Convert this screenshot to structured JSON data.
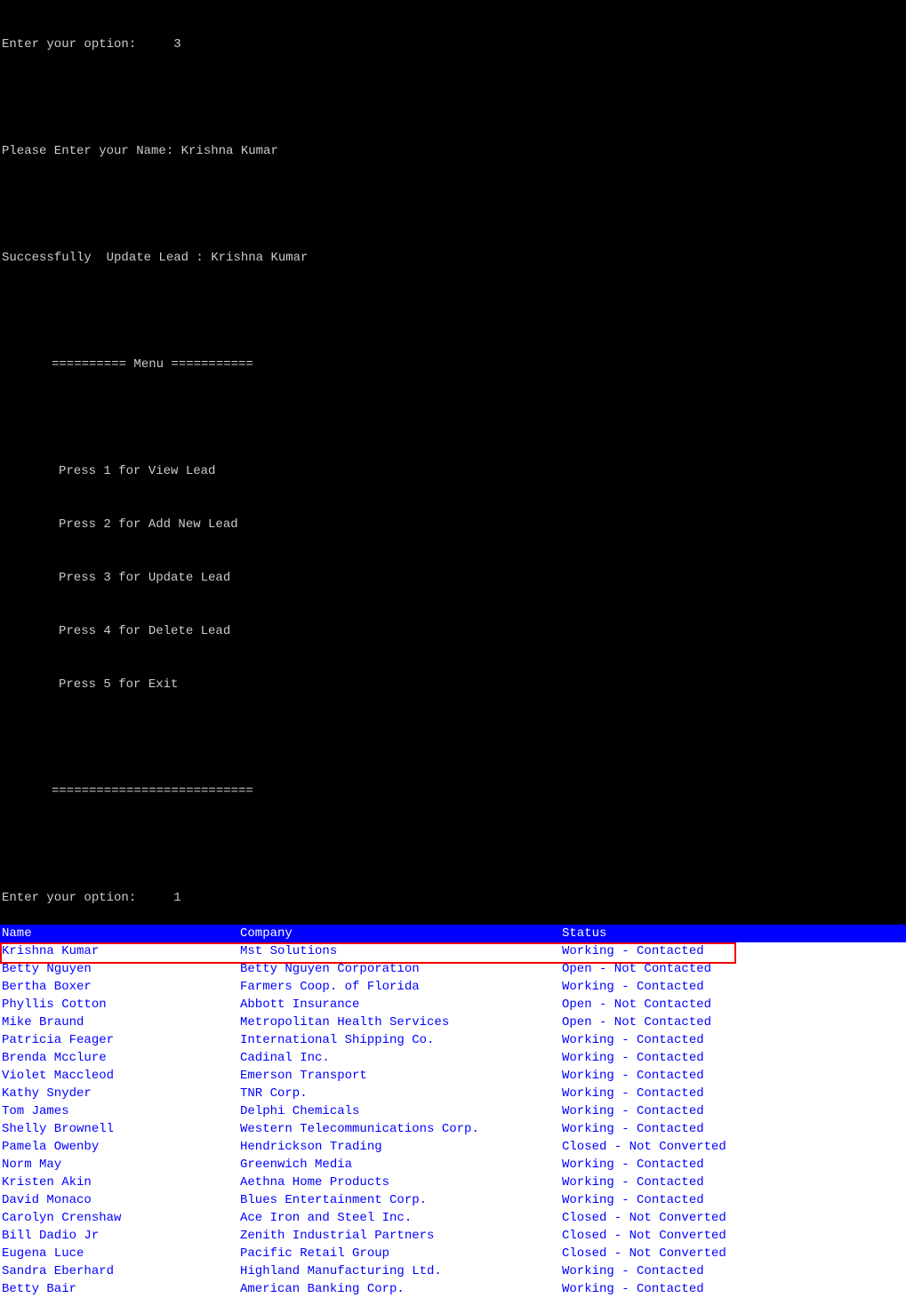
{
  "terminal": {
    "prompt1": "Enter your option:     3",
    "prompt2": "Please Enter your Name: Krishna Kumar",
    "success": "Successfully  Update Lead : Krishna Kumar",
    "menu_header": "========== Menu ===========",
    "menu_items": [
      "Press 1 for View Lead",
      "Press 2 for Add New Lead",
      "Press 3 for Update Lead",
      "Press 4 for Delete Lead",
      "Press 5 for Exit"
    ],
    "menu_footer": "===========================",
    "prompt3": "Enter your option:     1"
  },
  "table": {
    "headers": {
      "name": "Name",
      "company": "Company",
      "status": "Status"
    },
    "rows": [
      {
        "name": "Krishna Kumar",
        "company": "Mst Solutions",
        "status": "Working - Contacted",
        "highlighted": true
      },
      {
        "name": "Betty Nguyen",
        "company": "Betty Nguyen Corporation",
        "status": "Open - Not Contacted"
      },
      {
        "name": "Bertha Boxer",
        "company": "Farmers Coop. of Florida",
        "status": "Working - Contacted"
      },
      {
        "name": "Phyllis Cotton",
        "company": "Abbott Insurance",
        "status": "Open - Not Contacted"
      },
      {
        "name": "Mike Braund",
        "company": "Metropolitan Health Services",
        "status": "Open - Not Contacted"
      },
      {
        "name": "Patricia Feager",
        "company": "International Shipping Co.",
        "status": "Working - Contacted"
      },
      {
        "name": "Brenda Mcclure",
        "company": "Cadinal Inc.",
        "status": "Working - Contacted"
      },
      {
        "name": "Violet Maccleod",
        "company": "Emerson Transport",
        "status": "Working - Contacted"
      },
      {
        "name": "Kathy Snyder",
        "company": "TNR Corp.",
        "status": "Working - Contacted"
      },
      {
        "name": "Tom James",
        "company": "Delphi Chemicals",
        "status": "Working - Contacted"
      },
      {
        "name": "Shelly Brownell",
        "company": "Western Telecommunications Corp.",
        "status": "Working - Contacted"
      },
      {
        "name": "Pamela Owenby",
        "company": "Hendrickson Trading",
        "status": "Closed - Not Converted"
      },
      {
        "name": "Norm May",
        "company": "Greenwich Media",
        "status": "Working - Contacted"
      },
      {
        "name": "Kristen Akin",
        "company": "Aethna Home Products",
        "status": "Working - Contacted"
      },
      {
        "name": "David Monaco",
        "company": "Blues Entertainment Corp.",
        "status": "Working - Contacted"
      },
      {
        "name": "Carolyn Crenshaw",
        "company": "Ace Iron and Steel Inc.",
        "status": "Closed - Not Converted"
      },
      {
        "name": "Bill Dadio Jr",
        "company": "Zenith Industrial Partners",
        "status": "Closed - Not Converted"
      },
      {
        "name": "Eugena Luce",
        "company": "Pacific Retail Group",
        "status": "Closed - Not Converted"
      },
      {
        "name": "Sandra Eberhard",
        "company": "Highland Manufacturing Ltd.",
        "status": "Working - Contacted"
      },
      {
        "name": "Betty Bair",
        "company": "American Banking Corp.",
        "status": "Working - Contacted"
      }
    ]
  }
}
